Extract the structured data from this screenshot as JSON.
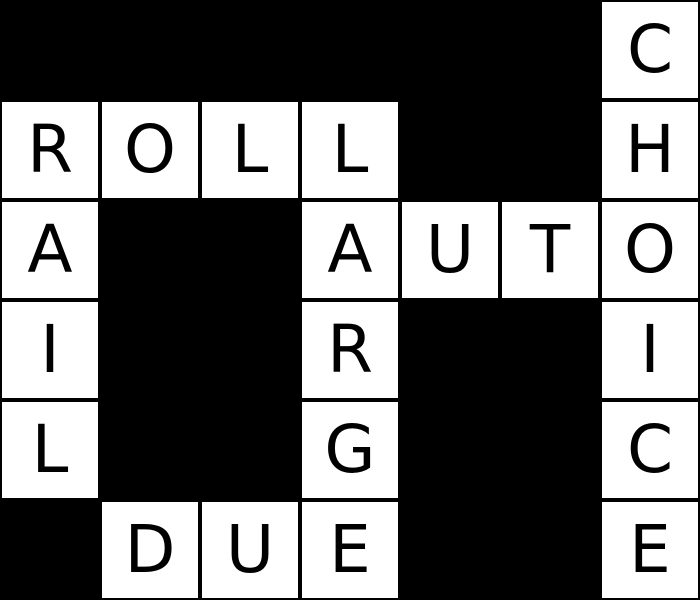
{
  "puzzle": {
    "grid": [
      [
        "#",
        "#",
        "#",
        "#",
        "#",
        "#",
        "C"
      ],
      [
        "R",
        "O",
        "L",
        "L",
        "#",
        "#",
        "H"
      ],
      [
        "A",
        "#",
        "#",
        "A",
        "U",
        "T",
        "O"
      ],
      [
        "I",
        "#",
        "#",
        "R",
        "#",
        "#",
        "I"
      ],
      [
        "L",
        "#",
        "#",
        "G",
        "#",
        "#",
        "C"
      ],
      [
        "#",
        "D",
        "U",
        "E",
        "#",
        "#",
        "E"
      ]
    ],
    "words": [
      "ROLL",
      "AUTO",
      "DUE",
      "RAIL",
      "LARGE",
      "CHOICE"
    ]
  }
}
